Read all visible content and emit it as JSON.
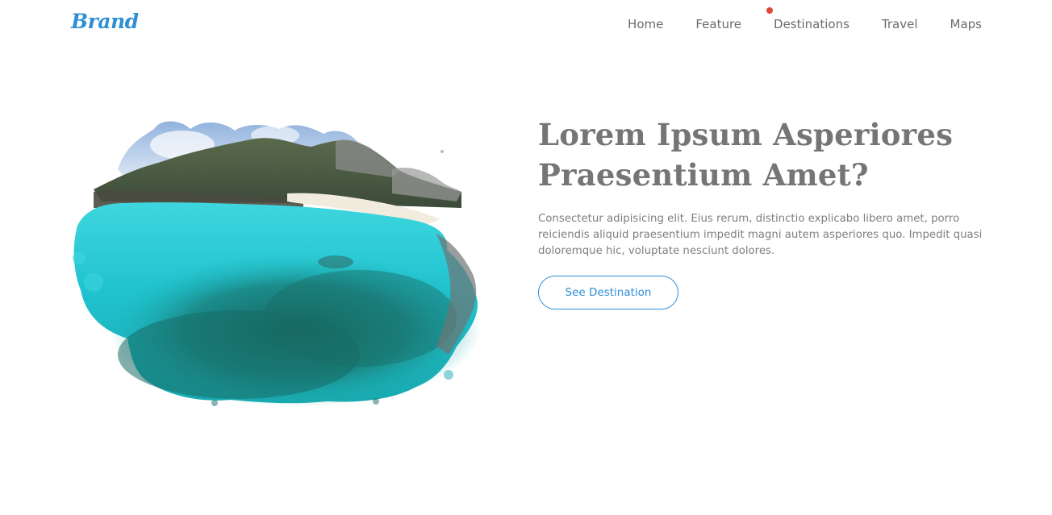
{
  "navbar": {
    "brand": "Brand",
    "items": [
      {
        "label": "Home",
        "active": false
      },
      {
        "label": "Feature",
        "active": false
      },
      {
        "label": "Destinations",
        "active": true
      },
      {
        "label": "Travel",
        "active": false
      },
      {
        "label": "Maps",
        "active": false
      }
    ],
    "active_indicator_color": "#e0493a"
  },
  "hero": {
    "title": "Lorem Ipsum Asperiores Praesentium Amet?",
    "description": "Consectetur adipisicing elit. Eius rerum, distinctio explicabo libero amet, porro reiciendis aliquid praesentium impedit magni autem asperiores quo. Impedit quasi doloremque hic, voluptate nesciunt dolores.",
    "button_label": "See Destination"
  },
  "colors": {
    "accent": "#2f8fd4",
    "heading": "#757575",
    "body_text": "#7f7f7f",
    "nav_text": "#6b6b6b",
    "water": "#1fc2cf",
    "reef": "#1a7f7a"
  }
}
